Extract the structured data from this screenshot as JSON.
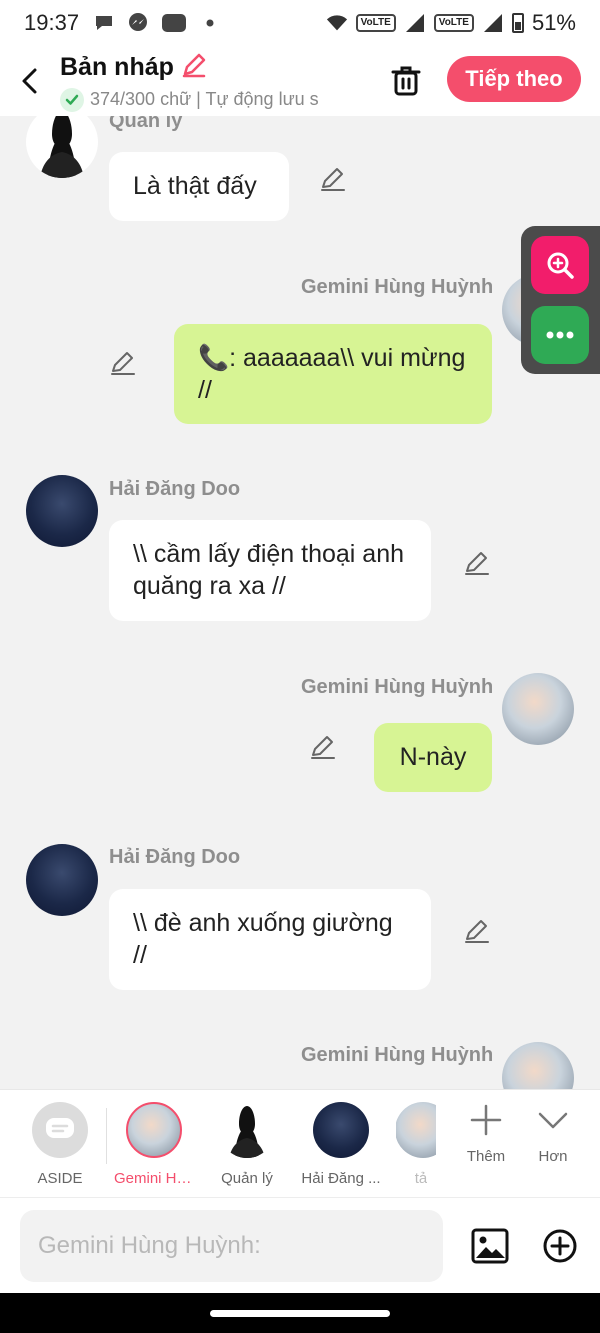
{
  "status_bar": {
    "time": "19:37",
    "battery": "51%",
    "network_1": "VoLTE",
    "network_2": "VoLTE",
    "zalo_label": "Zalo"
  },
  "header": {
    "title": "Bản nháp",
    "subtitle": "374/300 chữ | Tự động lưu s",
    "next_label": "Tiếp theo"
  },
  "messages": [
    {
      "sender": "Quản lý",
      "text": "Là thật đấy",
      "side": "left"
    },
    {
      "sender": "Gemini Hùng Huỳnh",
      "text": "📞: aaaaaaa\\\\ vui mừng //",
      "side": "right"
    },
    {
      "sender": "Hải Đăng Doo",
      "text": "\\\\ cầm lấy điện thoại anh quăng ra xa //",
      "side": "left"
    },
    {
      "sender": "Gemini Hùng Huỳnh",
      "text": "N-này",
      "side": "right"
    },
    {
      "sender": "Hải Đăng Doo",
      "text": "\\\\ đè anh xuống giường //",
      "side": "left"
    },
    {
      "sender": "Gemini Hùng Huỳnh",
      "text": "",
      "side": "right"
    }
  ],
  "characters": [
    {
      "label": "ASIDE"
    },
    {
      "label": "Gemini Hù..."
    },
    {
      "label": "Quản lý"
    },
    {
      "label": "Hải Đăng ..."
    },
    {
      "label": "tả"
    }
  ],
  "tools": {
    "add_label": "Thêm",
    "more_label": "Hơn"
  },
  "input": {
    "placeholder": "Gemini Hùng Huỳnh:"
  },
  "colors": {
    "accent": "#f44e6c",
    "green_bubble": "#d7f494",
    "zoom_button": "#f21d6b",
    "more_button": "#2faa55"
  }
}
